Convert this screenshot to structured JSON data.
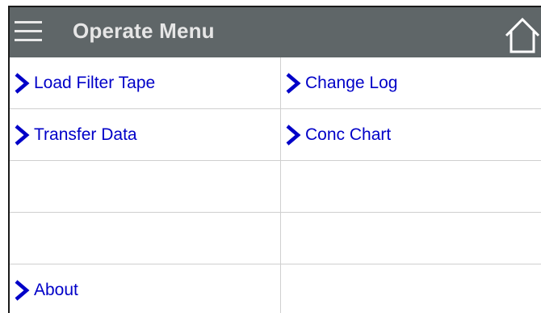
{
  "header": {
    "title": "Operate Menu",
    "menu_icon": "hamburger-icon",
    "home_icon": "home-icon",
    "background_color": "#5f6668",
    "text_color": "#e6e6e6"
  },
  "menu": {
    "link_color": "#0000c8",
    "chevron_icon": "chevron-right-icon",
    "rows": [
      {
        "left": "Load Filter Tape",
        "right": "Change Log"
      },
      {
        "left": "Transfer Data",
        "right": "Conc Chart"
      },
      {
        "left": "",
        "right": ""
      },
      {
        "left": "",
        "right": ""
      },
      {
        "left": "About",
        "right": ""
      }
    ]
  }
}
